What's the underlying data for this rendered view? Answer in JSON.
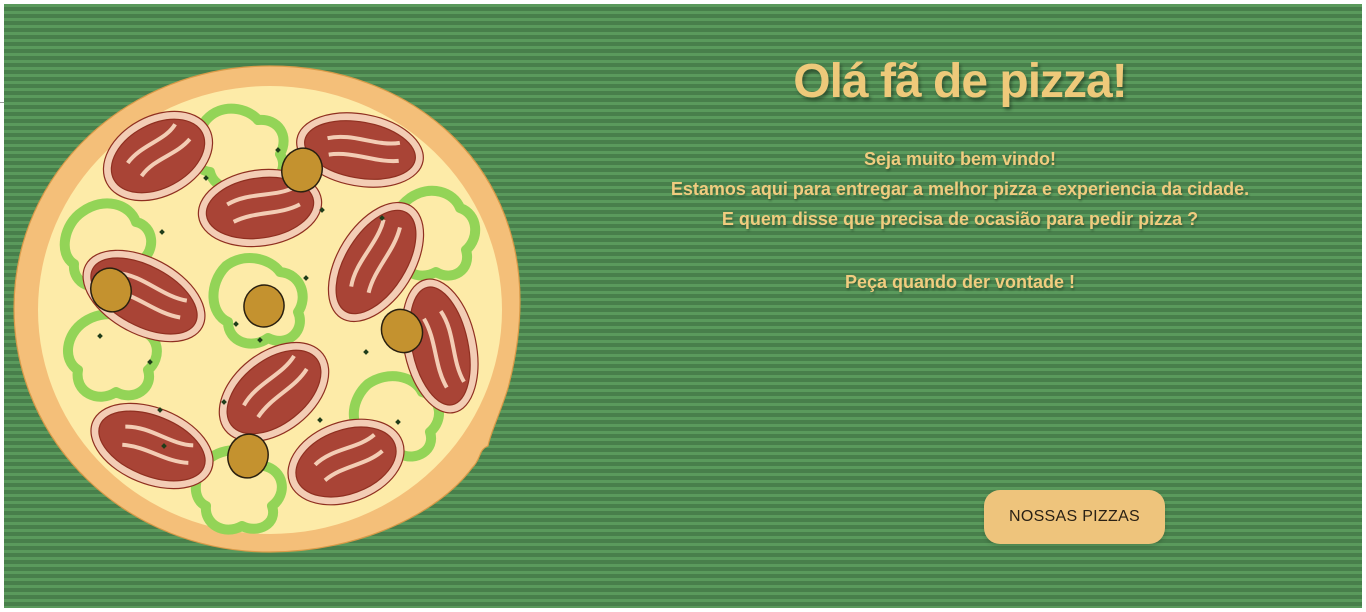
{
  "hero": {
    "title": "Olá fã de pizza!",
    "lines": [
      "Seja muito bem vindo!",
      "Estamos aqui para entregar a melhor pizza e experiencia da cidade.",
      "E quem disse que precisa de ocasião para pedir pizza ?",
      "Peça quando der vontade !"
    ],
    "button_label": "NOSSAS PIZZAS"
  },
  "colors": {
    "background": "#4f8a52",
    "title": "#eec97a",
    "button": "#eec47c",
    "button_text": "#2a2115"
  },
  "icons": {
    "pizza": "pizza-illustration"
  }
}
